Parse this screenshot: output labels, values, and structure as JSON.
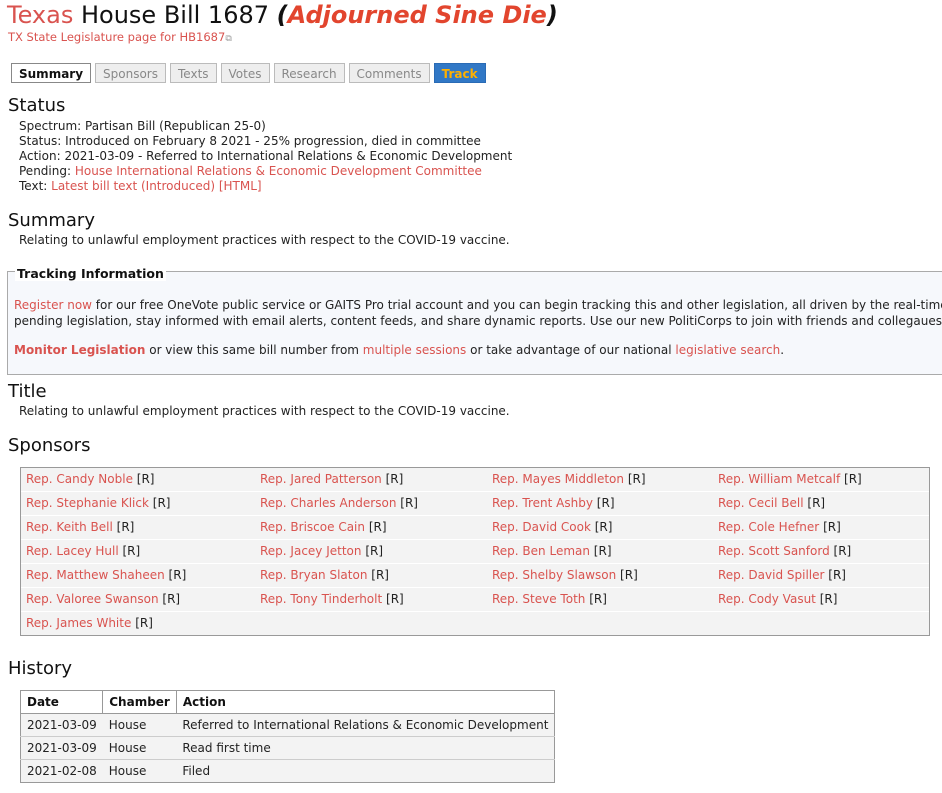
{
  "header": {
    "state": "Texas",
    "bill": "House Bill 1687",
    "status": "Adjourned Sine Die",
    "state_link": "TX State Legislature page for HB1687"
  },
  "tabs": [
    {
      "label": "Summary",
      "active": true
    },
    {
      "label": "Sponsors"
    },
    {
      "label": "Texts"
    },
    {
      "label": "Votes"
    },
    {
      "label": "Research"
    },
    {
      "label": "Comments"
    },
    {
      "label": "Track"
    }
  ],
  "status_section": {
    "heading": "Status",
    "spectrum_label": "Spectrum:",
    "spectrum_value": "Partisan Bill (Republican 25-0)",
    "status_label": "Status:",
    "status_value": "Introduced on February 8 2021 - 25% progression, died in committee",
    "action_label": "Action:",
    "action_value": "2021-03-09 - Referred to International Relations & Economic Development",
    "pending_label": "Pending:",
    "pending_value": "House International Relations & Economic Development Committee",
    "text_label": "Text:",
    "text_value": "Latest bill text (Introduced) [HTML]"
  },
  "summary_section": {
    "heading": "Summary",
    "text": "Relating to unlawful employment practices with respect to the COVID-19 vaccine."
  },
  "tracking": {
    "legend": "Tracking Information",
    "register_link": "Register now",
    "line1_rest": " for our free OneVote public service or GAITS Pro trial account and you can begin tracking this and other legislation, all driven by the real-time data",
    "line2": "pending legislation, stay informed with email alerts, content feeds, and share dynamic reports. Use our new PolitiCorps to join with friends and collegaues to mo",
    "monitor_link": "Monitor Legislation",
    "line3_a": " or view this same bill number from ",
    "sessions_link": "multiple sessions",
    "line3_b": " or take advantage of our national ",
    "search_link": "legislative search",
    "line3_c": "."
  },
  "title_section": {
    "heading": "Title",
    "text": "Relating to unlawful employment practices with respect to the COVID-19 vaccine."
  },
  "sponsors_section": {
    "heading": "Sponsors",
    "rows": [
      [
        {
          "name": "Rep. Candy Noble",
          "party": "[R]"
        },
        {
          "name": "Rep. Jared Patterson",
          "party": "[R]"
        },
        {
          "name": "Rep. Mayes Middleton",
          "party": "[R]"
        },
        {
          "name": "Rep. William Metcalf",
          "party": "[R]"
        }
      ],
      [
        {
          "name": "Rep. Stephanie Klick",
          "party": "[R]"
        },
        {
          "name": "Rep. Charles Anderson",
          "party": "[R]"
        },
        {
          "name": "Rep. Trent Ashby",
          "party": "[R]"
        },
        {
          "name": "Rep. Cecil Bell",
          "party": "[R]"
        }
      ],
      [
        {
          "name": "Rep. Keith Bell",
          "party": "[R]"
        },
        {
          "name": "Rep. Briscoe Cain",
          "party": "[R]"
        },
        {
          "name": "Rep. David Cook",
          "party": "[R]"
        },
        {
          "name": "Rep. Cole Hefner",
          "party": "[R]"
        }
      ],
      [
        {
          "name": "Rep. Lacey Hull",
          "party": "[R]"
        },
        {
          "name": "Rep. Jacey Jetton",
          "party": "[R]"
        },
        {
          "name": "Rep. Ben Leman",
          "party": "[R]"
        },
        {
          "name": "Rep. Scott Sanford",
          "party": "[R]"
        }
      ],
      [
        {
          "name": "Rep. Matthew Shaheen",
          "party": "[R]"
        },
        {
          "name": "Rep. Bryan Slaton",
          "party": "[R]"
        },
        {
          "name": "Rep. Shelby Slawson",
          "party": "[R]"
        },
        {
          "name": "Rep. David Spiller",
          "party": "[R]"
        }
      ],
      [
        {
          "name": "Rep. Valoree Swanson",
          "party": "[R]"
        },
        {
          "name": "Rep. Tony Tinderholt",
          "party": "[R]"
        },
        {
          "name": "Rep. Steve Toth",
          "party": "[R]"
        },
        {
          "name": "Rep. Cody Vasut",
          "party": "[R]"
        }
      ],
      [
        {
          "name": "Rep. James White",
          "party": "[R]"
        }
      ]
    ]
  },
  "history_section": {
    "heading": "History",
    "columns": [
      "Date",
      "Chamber",
      "Action"
    ],
    "rows": [
      [
        "2021-03-09",
        "House",
        "Referred to International Relations & Economic Development"
      ],
      [
        "2021-03-09",
        "House",
        "Read first time"
      ],
      [
        "2021-02-08",
        "House",
        "Filed"
      ]
    ]
  }
}
